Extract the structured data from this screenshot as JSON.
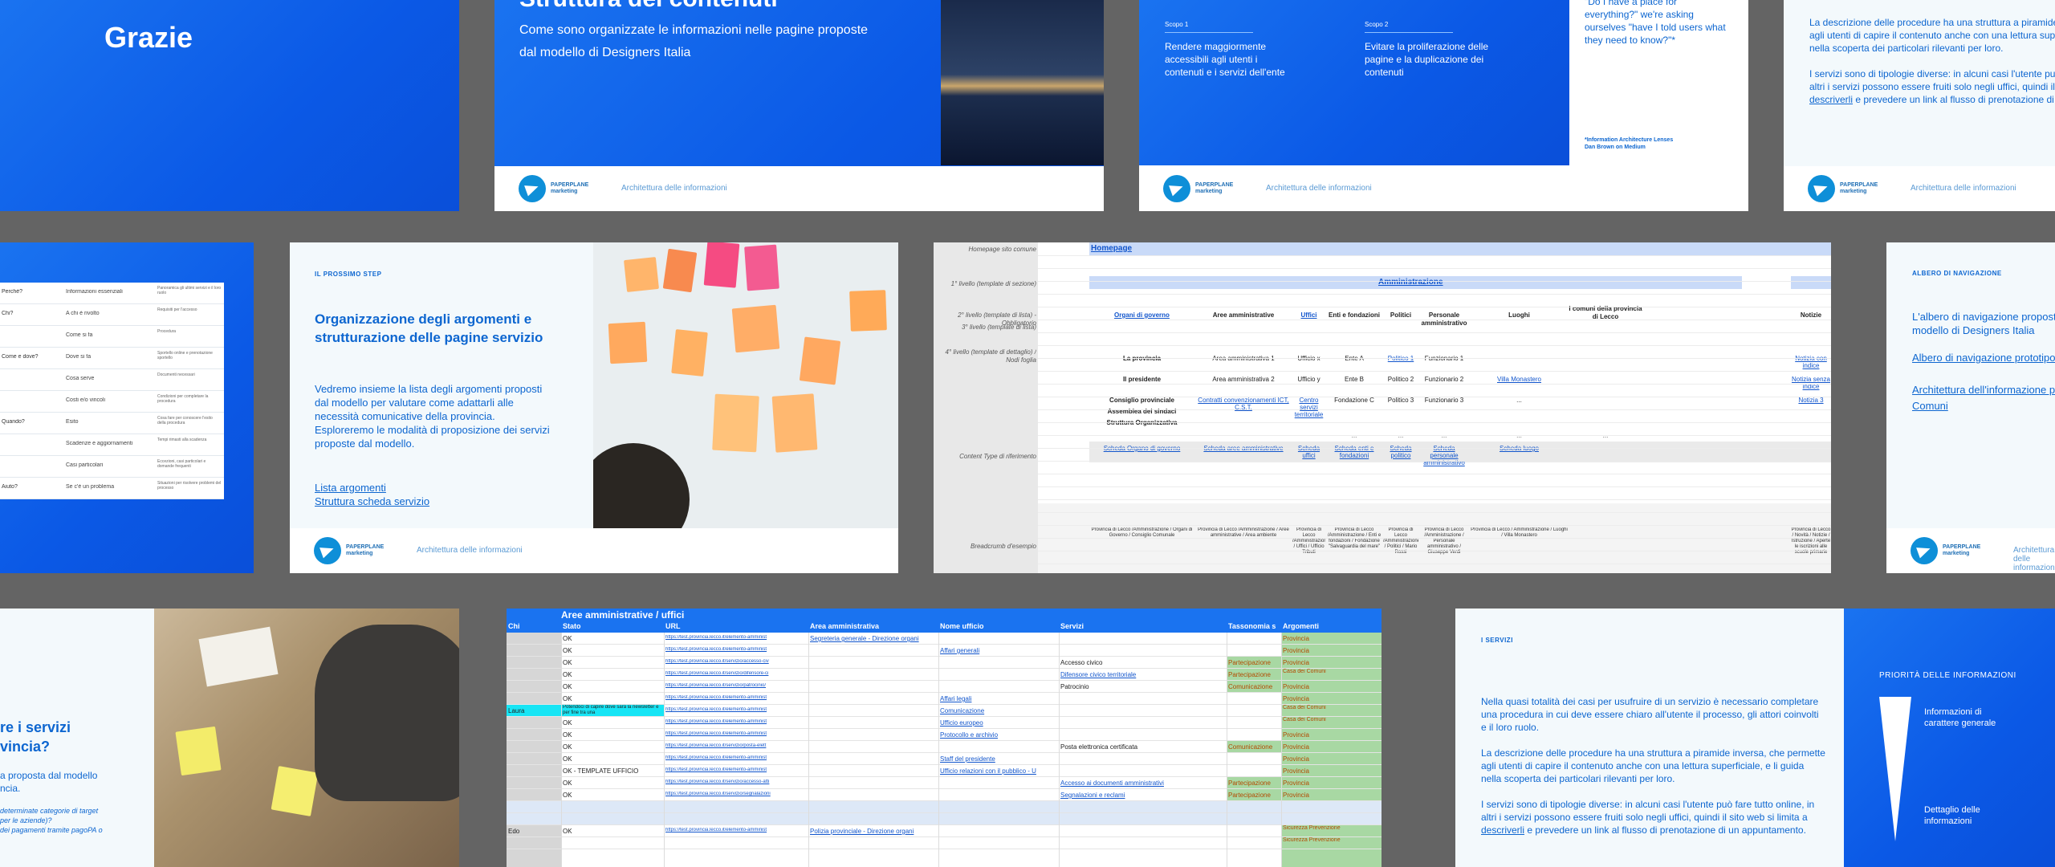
{
  "s1": {
    "title": "Grazie"
  },
  "s2": {
    "title": "Struttura dei contenuti",
    "subtitle": "Come sono organizzate le informazioni nelle pagine proposte dal modello di Designers Italia",
    "footer": "Architettura delle informazioni"
  },
  "s3": {
    "scopo1_label": "Scopo 1",
    "scopo1_text": "Rendere maggiormente accessibili agli utenti i contenuti e i servizi dell'ente",
    "scopo2_label": "Scopo 2",
    "scopo2_text": "Evitare la proliferazione delle pagine e la duplicazione dei contenuti",
    "quote": "\"Do I have a place for everything?\" we're asking ourselves \"have I told users what they need to know?\"*",
    "source": "*Information Architecture Lenses\nDan Brown on Medium",
    "footer": "Architettura delle informazioni"
  },
  "s4": {
    "p1": "La descrizione delle procedure ha una struttura a piramide inversa, che permette agli utenti di capire il contenuto anche con una lettura superficiale, e li guida nella scoperta dei particolari rilevanti per loro.",
    "p2_a": "I servizi sono di tipologie diverse: in alcuni casi l'utente può fare tutto online, in altri i servizi possono essere fruiti solo negli uffici, quindi il sito web si limita a ",
    "p2_link": "descriverli",
    "p2_b": " e prevedere un link al flusso di prenotazione di un appuntamento.",
    "footer": "Architettura delle informazioni"
  },
  "s5": {
    "rows": [
      [
        "Perché?",
        "Informazioni essenziali",
        "Panoramica gli ultimi servizi e il loro ruolo"
      ],
      [
        "Chi?",
        "A chi è rivolto",
        "Requisiti per l'accesso"
      ],
      [
        "",
        "Come si fa",
        "Procedura"
      ],
      [
        "Come e dove?",
        "Dove si fa",
        "Sportello online e prenotazione sportello"
      ],
      [
        "",
        "Cosa serve",
        "Documenti necessari"
      ],
      [
        "",
        "Costi e/o vincoli",
        "Condizioni per completare la procedura"
      ],
      [
        "Quando?",
        "Esito",
        "Cosa fare per conoscere l'esito della procedura"
      ],
      [
        "",
        "Scadenze e aggiornamenti",
        "Tempi rimasti alla scadenza"
      ],
      [
        "",
        "Casi particolari",
        "Eccezioni, casi particolari e domande frequenti"
      ],
      [
        "Aiuto?",
        "Se c'è un problema",
        "Situazioni per risolvere problemi del processo"
      ]
    ]
  },
  "s6": {
    "label": "IL PROSSIMO STEP",
    "title": "Organizzazione degli argomenti e strutturazione delle pagine servizio",
    "body": "Vedremo insieme la lista degli argomenti proposti dal modello per valutare come adattarli alle necessità comunicative della provincia.\nEsploreremo le modalità di proposizione dei servizi proposte dal modello.",
    "link1": "Lista argomenti",
    "link2": "Struttura scheda servizio",
    "footer": "Architettura delle informazioni"
  },
  "s7": {
    "homepage_label": "Homepage sito comune",
    "homepage": "Homepage",
    "level1_label": "1° livello (template di sezione)",
    "level1": "Amministrazione",
    "level2_label": "2° livello (template di lista) - Obbligatorio",
    "level3_label": "3° livello (template di lista)",
    "level4_label": "4° livello (template di dettaglio) / Nodi foglia",
    "headers": [
      "Organi di governo",
      "Aree amministrative",
      "Uffici",
      "Enti e fondazioni",
      "Politici",
      "Personale amministrativo",
      "Luoghi",
      "I comuni della provincia di Lecco",
      "Notizie"
    ],
    "rows": [
      [
        "La provincia",
        "Area amministrativa 1",
        "Ufficio x",
        "Ente A",
        "Politico 1",
        "Funzionario 1",
        "",
        "",
        "Notizia con indice"
      ],
      [
        "Il presidente",
        "Area amministrativa 2",
        "Ufficio y",
        "Ente B",
        "Politico 2",
        "Funzionario 2",
        "Villa Monastero",
        "",
        "Notizia senza indice"
      ],
      [
        "Consiglio provinciale",
        "Contratti convenzionamenti ICT, C.S.T.",
        "Centro servizi territoriale",
        "Fondazione C",
        "Politico 3",
        "Funzionario 3",
        "...",
        "",
        "Notizia 3"
      ],
      [
        "Assemblea dei sindaci",
        "",
        "",
        "",
        "",
        "",
        "",
        "",
        ""
      ],
      [
        "Struttura Organizzativa",
        "",
        "",
        "",
        "",
        "",
        "",
        "",
        ""
      ]
    ],
    "ellipsis": "...",
    "ct_label": "Content Type di riferimento",
    "ct": [
      "Scheda Organo di governo",
      "Scheda aree amministrative",
      "Scheda uffici",
      "Scheda enti e fondazioni",
      "Scheda politico",
      "Scheda personale amministrativo",
      "Scheda luogo"
    ],
    "bc_label": "Breadcrumb d'esempio",
    "bc": [
      "Provincia di Lecco /Amministrazione / Organi di Governo / Consiglio Comunale",
      "Provincia di Lecco /Amministrazione / Aree amministrative / Area ambiente",
      "Provincia di Lecco /Amministrazione / Uffici / Ufficio Tributi",
      "Provincia di Lecco /Amministrazione / Enti e fondazioni / Fondazione \"Salvaguardia del mare\"",
      "Provincia di Lecco /Amministrazione / Politici / Mario Rossi",
      "Provincia di Lecco /Amministrazione / Personale amministrativo / Giuseppe Verdi",
      "Provincia di Lecco / Amministrazione / Luoghi / Villa Monastero",
      "",
      "Provincia di Lecco / Novità / Notizie / Istruzione / Aperte le iscrizioni alle scuole primarie"
    ]
  },
  "s8": {
    "label": "ALBERO DI NAVIGAZIONE",
    "body": "L'albero di navigazione proposto dal modello di Designers Italia",
    "link1": "Albero di navigazione prototipo Comuni",
    "link2": "Architettura dell'informazione prototipo Comuni",
    "footer": "Architettura delle informazioni"
  },
  "s9": {
    "title": "re i servizi\nvincia?",
    "body": "a proposta dal modello\nncia.",
    "italic": "determinate categorie di target\nper le aziende)?\ndei pagamenti tramite pagoPA o"
  },
  "s10": {
    "title": "Aree amministrative / uffici",
    "headers": [
      "Chi",
      "Stato",
      "URL",
      "Area amministrativa",
      "Nome ufficio",
      "Servizi",
      "Tassonomia s",
      "Argomenti"
    ],
    "rows": [
      [
        "",
        "OK",
        "https://test.provincia.lecco.it/elemento-amminist",
        "Segreteria generale - Direzione organi",
        "",
        "",
        "",
        "Provincia"
      ],
      [
        "",
        "OK",
        "https://test.provincia.lecco.it/elemento-amminist",
        "",
        "Affari generali",
        "",
        "",
        "Provincia"
      ],
      [
        "",
        "OK",
        "https://test.provincia.lecco.it/servizio/accesso-civ",
        "",
        "",
        "Accesso civico",
        "Partecipazione",
        "Provincia"
      ],
      [
        "",
        "OK",
        "https://test.provincia.lecco.it/servizio/difensore-ci",
        "",
        "",
        "Difensore civico territoriale",
        "Partecipazione",
        "Casa dei Comuni"
      ],
      [
        "",
        "OK",
        "https://test.provincia.lecco.it/servizio/patrocinio/",
        "",
        "",
        "Patrocinio",
        "Comunicazione",
        "Provincia"
      ],
      [
        "",
        "OK",
        "https://test.provincia.lecco.it/elemento-amminist",
        "",
        "Affari legali",
        "",
        "",
        "Provincia"
      ],
      [
        "Laura",
        "Potendoci di capire dove sarà la newsletter e per fine tra una",
        "https://test.provincia.lecco.it/elemento-amminist",
        "",
        "Comunicazione",
        "",
        "",
        "Casa dei Comuni"
      ],
      [
        "",
        "OK",
        "https://test.provincia.lecco.it/elemento-amminist",
        "",
        "Ufficio europeo",
        "",
        "",
        "Casa dei Comuni"
      ],
      [
        "",
        "OK",
        "https://test.provincia.lecco.it/elemento-amminist",
        "",
        "Protocollo e archivio",
        "",
        "",
        "Provincia"
      ],
      [
        "",
        "OK",
        "https://test.provincia.lecco.it/servizio/posta-elett",
        "",
        "",
        "Posta elettronica certificata",
        "Comunicazione",
        "Provincia"
      ],
      [
        "",
        "OK",
        "https://test.provincia.lecco.it/elemento-amminist",
        "",
        "Staff del presidente",
        "",
        "",
        "Provincia"
      ],
      [
        "",
        "OK - TEMPLATE UFFICIO",
        "https://test.provincia.lecco.it/elemento-amminist",
        "",
        "Ufficio relazioni con il pubblico - U",
        "",
        "",
        "Provincia"
      ],
      [
        "",
        "OK",
        "https://test.provincia.lecco.it/servizio/accesso-atti",
        "",
        "",
        "Accesso ai documenti amministrativi",
        "Partecipazione",
        "Provincia"
      ],
      [
        "",
        "OK",
        "https://test.provincia.lecco.it/servizio/segnalazioni",
        "",
        "",
        "Segnalazioni e reclami",
        "Partecipazione",
        "Provincia"
      ],
      [
        "",
        "",
        "",
        "",
        "",
        "",
        "",
        ""
      ],
      [
        "",
        "",
        "",
        "",
        "",
        "",
        "",
        ""
      ],
      [
        "Edo",
        "OK",
        "https://test.provincia.lecco.it/elemento-amminist",
        "Polizia provinciale - Direzione organi",
        "",
        "",
        "",
        "Sicurezza Prevenzione"
      ],
      [
        "",
        "",
        "",
        "",
        "",
        "",
        "",
        "Sicurezza Prevenzione"
      ]
    ]
  },
  "s11": {
    "label": "I SERVIZI",
    "p1": "Nella quasi totalità dei casi per usufruire di un servizio è necessario completare una procedura in cui deve essere chiaro all'utente il processo, gli attori coinvolti e il loro ruolo.",
    "p2": "La descrizione delle procedure ha una struttura a piramide inversa, che permette agli utenti di capire il contenuto anche con una lettura superficiale, e li guida nella scoperta dei particolari rilevanti per loro.",
    "p3_a": "I servizi sono di tipologie diverse: in alcuni casi l'utente può fare tutto online, in altri i servizi possono essere fruiti solo negli uffici, quindi il sito web si limita a ",
    "p3_link": "descriverli",
    "p3_b": " e prevedere un link al flusso di prenotazione di un appuntamento.",
    "priority_label": "PRIORITÀ DELLE INFORMAZIONI",
    "top_label": "Informazioni di carattere generale",
    "bottom_label": "Dettaglio delle informazioni"
  },
  "logo_text": "PAPERPLANE\nmarketing"
}
